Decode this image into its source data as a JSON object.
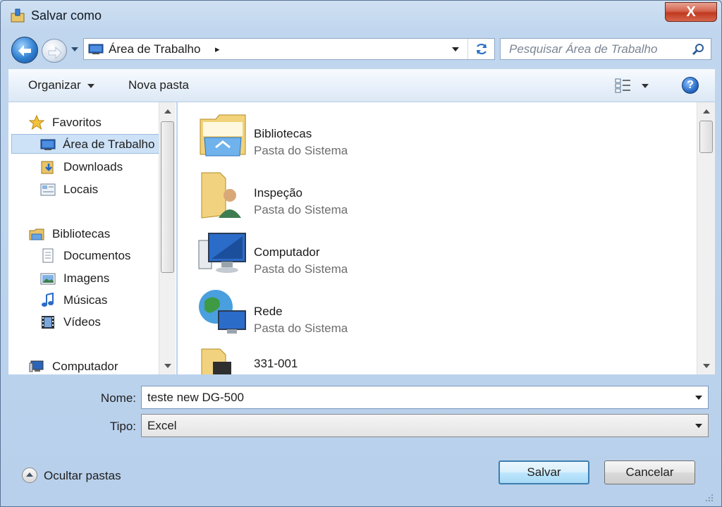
{
  "window": {
    "title": "Salvar como",
    "close_label": "X"
  },
  "address": {
    "location": "Área de Trabalho",
    "chevron": "▸"
  },
  "search": {
    "placeholder": "Pesquisar Área de Trabalho"
  },
  "toolbar": {
    "organize_label": "Organizar",
    "new_folder_label": "Nova pasta",
    "help_label": "?"
  },
  "nav": {
    "items": [
      {
        "label": "Favoritos",
        "icon": "star-icon"
      },
      {
        "label": "Área de Trabalho",
        "icon": "desktop-icon",
        "selected": true
      },
      {
        "label": "Downloads",
        "icon": "downloads-icon"
      },
      {
        "label": "Locais",
        "icon": "recent-places-icon"
      },
      {
        "label": "Bibliotecas",
        "icon": "libraries-icon"
      },
      {
        "label": "Documentos",
        "icon": "documents-icon"
      },
      {
        "label": "Imagens",
        "icon": "pictures-icon"
      },
      {
        "label": "Músicas",
        "icon": "music-icon"
      },
      {
        "label": "Vídeos",
        "icon": "videos-icon"
      },
      {
        "label": "Computador",
        "icon": "computer-icon"
      }
    ]
  },
  "files": [
    {
      "name": "Bibliotecas",
      "sub": "Pasta do Sistema",
      "icon": "libraries-folder-icon"
    },
    {
      "name": "Inspeção",
      "sub": "Pasta do Sistema",
      "icon": "user-folder-icon"
    },
    {
      "name": "Computador",
      "sub": "Pasta do Sistema",
      "icon": "computer-icon"
    },
    {
      "name": "Rede",
      "sub": "Pasta do Sistema",
      "icon": "network-icon"
    },
    {
      "name": "331-001",
      "sub": "",
      "icon": "folder-icon"
    }
  ],
  "form": {
    "name_label": "Nome:",
    "name_value": "teste new DG-500",
    "type_label": "Tipo:",
    "type_value": "Excel"
  },
  "footer": {
    "hide_folders_label": "Ocultar pastas",
    "save_label": "Salvar",
    "cancel_label": "Cancelar"
  },
  "colors": {
    "accent": "#3c7fb1",
    "selection": "#cde2f7",
    "title_close": "#c0391f"
  }
}
